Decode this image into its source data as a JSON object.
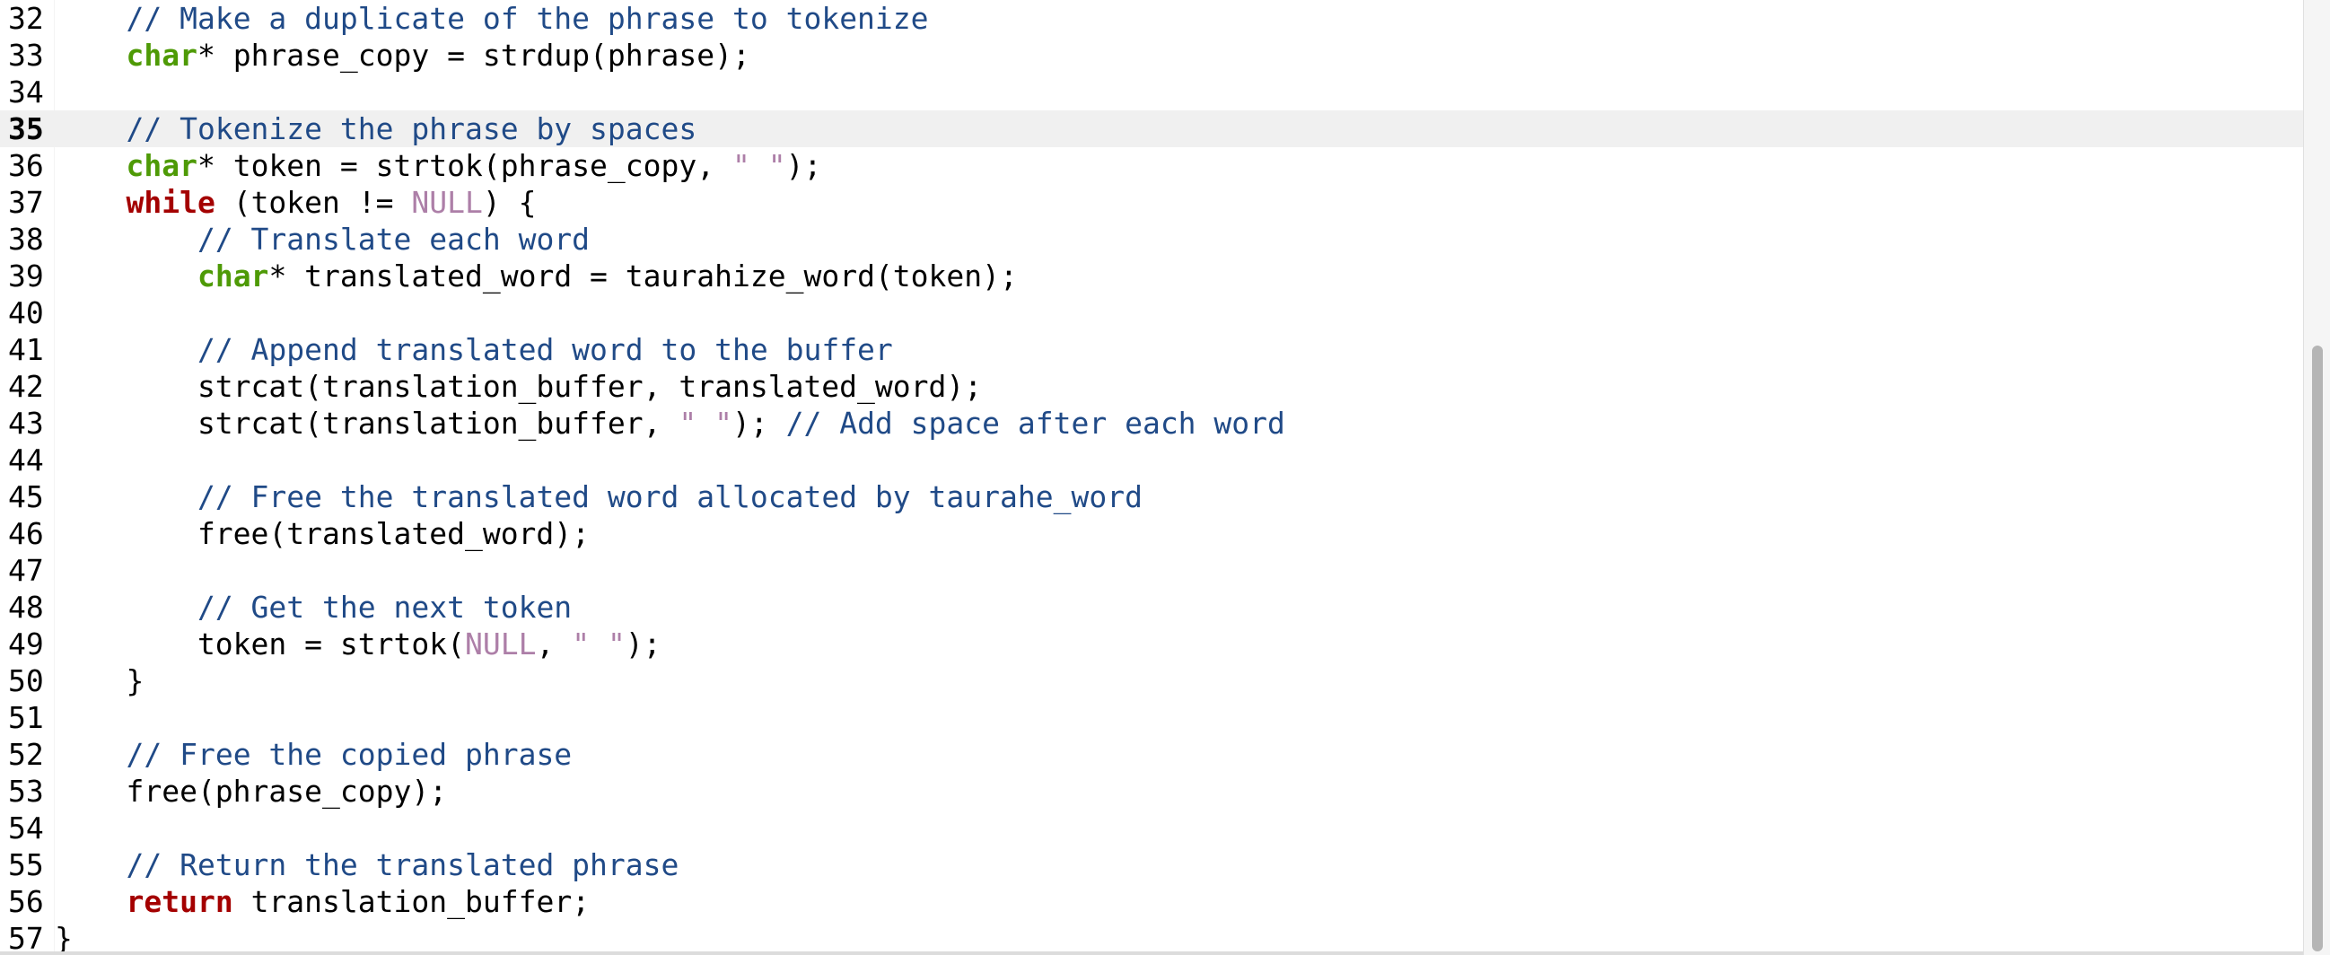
{
  "editor": {
    "current_line": "35",
    "lines": [
      {
        "n": "32",
        "tokens": [
          {
            "t": "    "
          },
          {
            "t": "// Make a duplicate of the phrase to tokenize",
            "c": "cmt"
          }
        ]
      },
      {
        "n": "33",
        "tokens": [
          {
            "t": "    "
          },
          {
            "t": "char",
            "c": "kw-type"
          },
          {
            "t": "* phrase_copy = strdup(phrase);"
          }
        ]
      },
      {
        "n": "34",
        "tokens": []
      },
      {
        "n": "35",
        "tokens": [
          {
            "t": "    "
          },
          {
            "t": "// Tokenize the phrase by spaces",
            "c": "cmt"
          }
        ]
      },
      {
        "n": "36",
        "tokens": [
          {
            "t": "    "
          },
          {
            "t": "char",
            "c": "kw-type"
          },
          {
            "t": "* token = strtok(phrase_copy, "
          },
          {
            "t": "\" \"",
            "c": "str"
          },
          {
            "t": ");"
          }
        ]
      },
      {
        "n": "37",
        "tokens": [
          {
            "t": "    "
          },
          {
            "t": "while",
            "c": "kw-ctrl"
          },
          {
            "t": " (token != "
          },
          {
            "t": "NULL",
            "c": "const"
          },
          {
            "t": ") {"
          }
        ]
      },
      {
        "n": "38",
        "tokens": [
          {
            "t": "        "
          },
          {
            "t": "// Translate each word",
            "c": "cmt"
          }
        ]
      },
      {
        "n": "39",
        "tokens": [
          {
            "t": "        "
          },
          {
            "t": "char",
            "c": "kw-type"
          },
          {
            "t": "* translated_word = taurahize_word(token);"
          }
        ]
      },
      {
        "n": "40",
        "tokens": []
      },
      {
        "n": "41",
        "tokens": [
          {
            "t": "        "
          },
          {
            "t": "// Append translated word to the buffer",
            "c": "cmt"
          }
        ]
      },
      {
        "n": "42",
        "tokens": [
          {
            "t": "        strcat(translation_buffer, translated_word);"
          }
        ]
      },
      {
        "n": "43",
        "tokens": [
          {
            "t": "        strcat(translation_buffer, "
          },
          {
            "t": "\" \"",
            "c": "str"
          },
          {
            "t": "); "
          },
          {
            "t": "// Add space after each word",
            "c": "cmt"
          }
        ]
      },
      {
        "n": "44",
        "tokens": []
      },
      {
        "n": "45",
        "tokens": [
          {
            "t": "        "
          },
          {
            "t": "// Free the translated word allocated by taurahe_word",
            "c": "cmt"
          }
        ]
      },
      {
        "n": "46",
        "tokens": [
          {
            "t": "        free(translated_word);"
          }
        ]
      },
      {
        "n": "47",
        "tokens": []
      },
      {
        "n": "48",
        "tokens": [
          {
            "t": "        "
          },
          {
            "t": "// Get the next token",
            "c": "cmt"
          }
        ]
      },
      {
        "n": "49",
        "tokens": [
          {
            "t": "        token = strtok("
          },
          {
            "t": "NULL",
            "c": "const"
          },
          {
            "t": ", "
          },
          {
            "t": "\" \"",
            "c": "str"
          },
          {
            "t": ");"
          }
        ]
      },
      {
        "n": "50",
        "tokens": [
          {
            "t": "    }"
          }
        ]
      },
      {
        "n": "51",
        "tokens": []
      },
      {
        "n": "52",
        "tokens": [
          {
            "t": "    "
          },
          {
            "t": "// Free the copied phrase",
            "c": "cmt"
          }
        ]
      },
      {
        "n": "53",
        "tokens": [
          {
            "t": "    free(phrase_copy);"
          }
        ]
      },
      {
        "n": "54",
        "tokens": []
      },
      {
        "n": "55",
        "tokens": [
          {
            "t": "    "
          },
          {
            "t": "// Return the translated phrase",
            "c": "cmt"
          }
        ]
      },
      {
        "n": "56",
        "tokens": [
          {
            "t": "    "
          },
          {
            "t": "return",
            "c": "kw-ctrl"
          },
          {
            "t": " translation_buffer;"
          }
        ]
      },
      {
        "n": "57",
        "tokens": [
          {
            "t": "}"
          }
        ]
      }
    ]
  },
  "colors": {
    "comment": "#204a87",
    "type_keyword": "#4e9a06",
    "control_keyword": "#a40000",
    "string_literal": "#ad7fa8",
    "current_line_bg": "#f0f0f0"
  }
}
